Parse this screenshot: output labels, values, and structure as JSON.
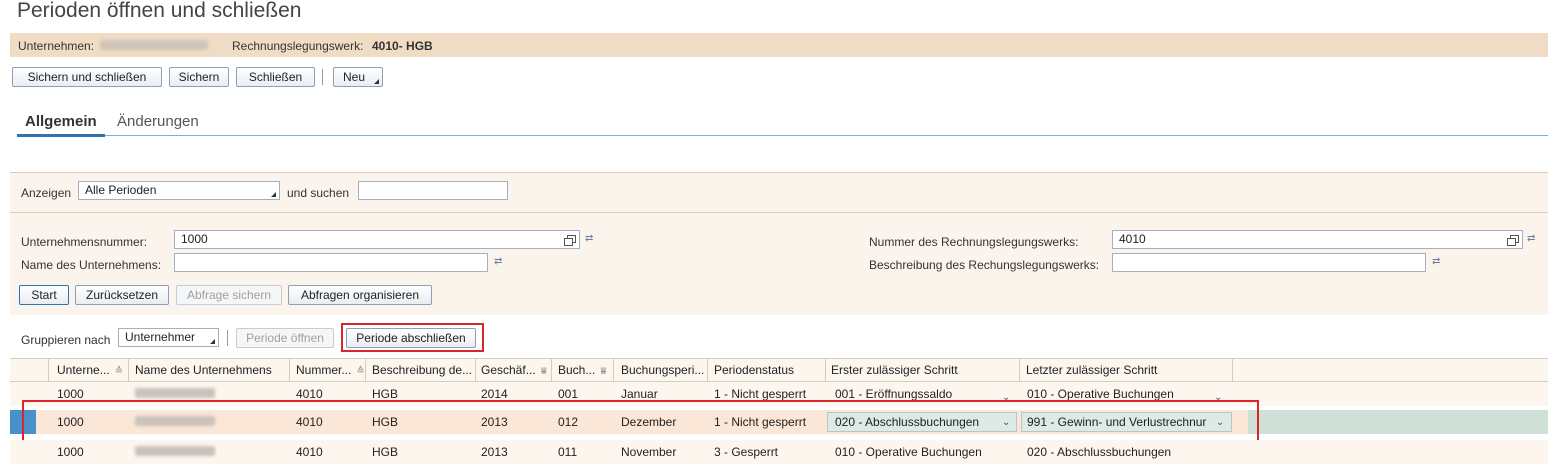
{
  "page": {
    "title": "Perioden öffnen und schließen"
  },
  "header": {
    "company_label": "Unternehmen:",
    "ledger_label": "Rechnungslegungswerk:",
    "ledger_value": "4010- HGB"
  },
  "toolbar": {
    "save_close": "Sichern und schließen",
    "save": "Sichern",
    "close": "Schließen",
    "new": "Neu"
  },
  "tabs": {
    "general": "Allgemein",
    "changes": "Änderungen"
  },
  "filter": {
    "show_label": "Anzeigen",
    "show_value": "Alle Perioden",
    "search_label": "und suchen",
    "search_value": ""
  },
  "query": {
    "company_number_label": "Unternehmensnummer:",
    "company_number_value": "1000",
    "company_name_label": "Name des Unternehmens:",
    "company_name_value": "",
    "ledger_number_label": "Nummer des Rechnungslegungswerks:",
    "ledger_number_value": "4010",
    "ledger_desc_label": "Beschreibung des Rechungslegungswerks:",
    "ledger_desc_value": "",
    "start": "Start",
    "reset": "Zurücksetzen",
    "save_query": "Abfrage sichern",
    "organize_queries": "Abfragen organisieren"
  },
  "grid_toolbar": {
    "group_label": "Gruppieren nach",
    "group_value": "Unternehmer",
    "open_period": "Periode öffnen",
    "close_period": "Periode abschließen"
  },
  "table": {
    "columns": [
      "Unterne...",
      "Name des Unternehmens",
      "Nummer...",
      "Beschreibung de...",
      "Geschäf...",
      "Buch...",
      "Buchungsperi...",
      "Periodenstatus",
      "Erster zulässiger Schritt",
      "Letzter zulässiger Schritt"
    ],
    "rows": [
      [
        "1000",
        "",
        "4010",
        "HGB",
        "2014",
        "001",
        "Januar",
        "1 - Nicht gesperrt",
        "001 - Eröffnungssaldo",
        "010 - Operative Buchungen"
      ],
      [
        "1000",
        "",
        "4010",
        "HGB",
        "2013",
        "012",
        "Dezember",
        "1 - Nicht gesperrt",
        "020 - Abschlussbuchungen",
        "991 - Gewinn- und Verlustrechnur"
      ],
      [
        "1000",
        "",
        "4010",
        "HGB",
        "2013",
        "011",
        "November",
        "3 - Gesperrt",
        "010 - Operative Buchungen",
        "020 - Abschlussbuchungen"
      ]
    ]
  },
  "colors": {
    "header_band": "#f0dcc4",
    "selected_row": "#cfe0d6",
    "highlight_border": "#d9262e",
    "tab_accent": "#2d75b0"
  }
}
